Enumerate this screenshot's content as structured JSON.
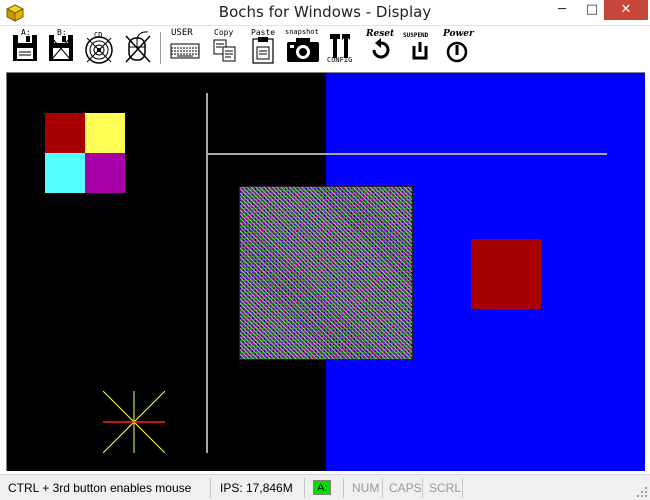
{
  "window": {
    "title": "Bochs for Windows - Display",
    "controls": {
      "minimize": "─",
      "maximize": "□",
      "close": "✕"
    }
  },
  "toolbar": {
    "floppy_a": {
      "label": "A:",
      "icon": "floppy-icon"
    },
    "floppy_b": {
      "label": "B:",
      "icon": "floppy-icon"
    },
    "cdrom": {
      "label": "CD",
      "icon": "cdrom-icon"
    },
    "mouse": {
      "icon": "mouse-icon"
    },
    "user": {
      "label": "USER",
      "icon": "keyboard-icon"
    },
    "copy": {
      "label": "Copy",
      "icon": "copy-icon"
    },
    "paste": {
      "label": "Paste",
      "icon": "paste-icon"
    },
    "snapshot": {
      "label": "snapshot",
      "icon": "camera-icon"
    },
    "config": {
      "label": "CONFIG",
      "icon": "tools-icon"
    },
    "reset": {
      "label": "Reset",
      "icon": "reset-icon"
    },
    "suspend": {
      "label": "SUSPEND",
      "icon": "suspend-icon"
    },
    "power": {
      "label": "Power",
      "icon": "power-icon"
    }
  },
  "colors": {
    "display_black": "#000000",
    "display_blue": "#0000ff",
    "red": "#a80000",
    "yellow": "#ffff55",
    "cyan": "#55ffff",
    "magenta": "#a800a8",
    "drive_led": "#00e000"
  },
  "statusbar": {
    "message": "CTRL + 3rd button enables mouse",
    "ips": "IPS: 17,846M",
    "drive": "A:",
    "num": "NUM",
    "caps": "CAPS",
    "scrl": "SCRL"
  }
}
